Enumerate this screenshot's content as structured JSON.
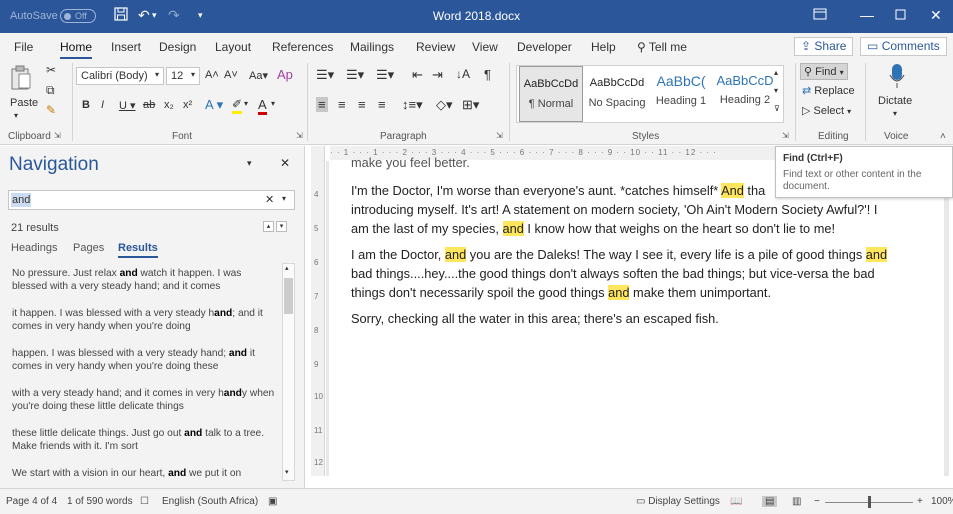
{
  "titlebar": {
    "autosave_label": "AutoSave",
    "autosave_state": "Off",
    "doc_title": "Word 2018.docx"
  },
  "tabs": [
    "File",
    "Home",
    "Insert",
    "Design",
    "Layout",
    "References",
    "Mailings",
    "Review",
    "View",
    "Developer",
    "Help"
  ],
  "tell_me": "Tell me",
  "share_label": "Share",
  "comments_label": "Comments",
  "ribbon": {
    "clipboard": {
      "paste": "Paste",
      "group": "Clipboard"
    },
    "font": {
      "name": "Calibri (Body)",
      "size": "12",
      "group": "Font"
    },
    "paragraph": {
      "group": "Paragraph"
    },
    "styles": {
      "group": "Styles",
      "items": [
        {
          "preview": "AaBbCcDd",
          "name": "¶ Normal"
        },
        {
          "preview": "AaBbCcDd",
          "name": "No Spacing"
        },
        {
          "preview": "AaBbC(",
          "name": "Heading 1"
        },
        {
          "preview": "AaBbCcD",
          "name": "Heading 2"
        }
      ]
    },
    "editing": {
      "find": "Find",
      "replace": "Replace",
      "select": "Select",
      "group": "Editing"
    },
    "voice": {
      "dictate": "Dictate",
      "group": "Voice"
    }
  },
  "tooltip": {
    "title": "Find (Ctrl+F)",
    "description": "Find text or other content in the document."
  },
  "navigation": {
    "title": "Navigation",
    "search_value": "and",
    "results_count": "21 results",
    "tabs": [
      "Headings",
      "Pages",
      "Results"
    ],
    "results": [
      {
        "pre": "No pressure. Just relax ",
        "hit": "and",
        "post": " watch it happen. I was blessed with a very steady hand; and it comes"
      },
      {
        "pre": "it happen. I was blessed with a very steady h",
        "hit": "and",
        "post": "; and it comes in very handy when you're doing"
      },
      {
        "pre": "happen. I was blessed with a very steady hand; ",
        "hit": "and",
        "post": " it comes in very handy when you're doing these"
      },
      {
        "pre": "with a very steady hand; and it comes in very h",
        "hit": "and",
        "post": "y when you're doing these little delicate things"
      },
      {
        "pre": "these little delicate things. Just go out ",
        "hit": "and",
        "post": " talk to a tree. Make friends with it. I'm sort"
      },
      {
        "pre": "We start with a vision in our heart, ",
        "hit": "and",
        "post": " we put it on"
      }
    ]
  },
  "document": {
    "partial_top": "make you feel better.",
    "paragraphs": [
      [
        {
          "t": "I'm the Doctor, I'm worse than everyone's aunt. *catches himself* "
        },
        {
          "t": "And",
          "hl": true
        },
        {
          "t": " tha"
        }
      ],
      [
        {
          "t": "introducing myself. It's art! A statement on modern society, 'Oh Ain't Modern Society Awful?'! I"
        }
      ],
      [
        {
          "t": "am the last of my species, "
        },
        {
          "t": "and",
          "hl": true
        },
        {
          "t": " I know how that weighs on the heart so don't lie to me!"
        }
      ],
      [
        {
          "t": "I am the Doctor, "
        },
        {
          "t": "and",
          "hl": true
        },
        {
          "t": " you are the Daleks! The way I see it, every life is a pile of good things "
        },
        {
          "t": "and",
          "hl": true
        }
      ],
      [
        {
          "t": "bad things....hey....the good things don't always soften the bad things; but vice-versa the bad"
        }
      ],
      [
        {
          "t": "things don't necessarily spoil the good things "
        },
        {
          "t": "and",
          "hl": true
        },
        {
          "t": " make them unimportant."
        }
      ],
      [
        {
          "t": "Sorry, checking all the water in this area; there's an escaped fish."
        }
      ]
    ]
  },
  "status": {
    "page": "Page 4 of 4",
    "words": "1 of 590 words",
    "language": "English (South Africa)",
    "display_settings": "Display Settings",
    "zoom": "100%"
  },
  "colors": {
    "title_blue": "#2b579a",
    "highlight": "#ffe65c",
    "ribbon_bg": "#f3f3f3"
  }
}
